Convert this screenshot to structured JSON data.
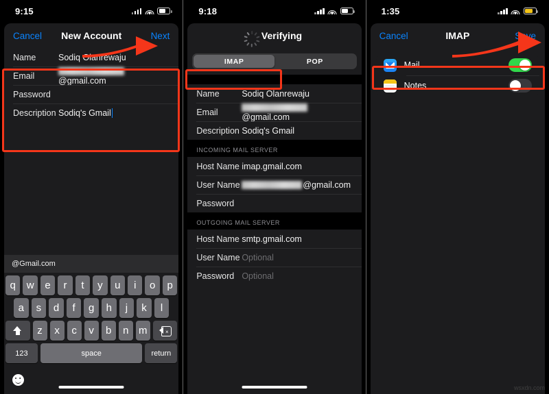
{
  "watermark": "wsxdn.com",
  "accent_blue": "#0a84ff",
  "highlight_red": "#f5361a",
  "toggle_green": "#32d74b",
  "panel1": {
    "status": {
      "time": "9:15",
      "battery": "full",
      "battery_color": "#ffffff"
    },
    "nav": {
      "left": "Cancel",
      "title": "New Account",
      "right": "Next"
    },
    "form_rows": [
      {
        "label": "Name",
        "value": "Sodiq Olanrewaju",
        "redacted": false
      },
      {
        "label": "Email",
        "value": "@gmail.com",
        "redacted": true
      },
      {
        "label": "Password",
        "value": "",
        "redacted": false
      },
      {
        "label": "Description",
        "value": "Sodiq's Gmail",
        "redacted": false
      }
    ],
    "keyboard": {
      "suggestions": [
        "@Gmail.com",
        "",
        ""
      ],
      "row1": [
        "q",
        "w",
        "e",
        "r",
        "t",
        "y",
        "u",
        "i",
        "o",
        "p"
      ],
      "row2": [
        "a",
        "s",
        "d",
        "f",
        "g",
        "h",
        "j",
        "k",
        "l"
      ],
      "row3": [
        "z",
        "x",
        "c",
        "v",
        "b",
        "n",
        "m"
      ],
      "shift_icon": "shift-icon",
      "delete_icon": "backspace-icon",
      "numbers_key": "123",
      "space_key": "space",
      "return_key": "return",
      "emoji_icon": "emoji-smiley-icon"
    }
  },
  "panel2": {
    "status": {
      "time": "9:18",
      "battery": "full",
      "battery_color": "#ffffff"
    },
    "nav": {
      "title": "Verifying",
      "spinner": "activity-spinner-icon"
    },
    "segmented": {
      "options": [
        "IMAP",
        "POP"
      ],
      "selected": "IMAP"
    },
    "account_rows": [
      {
        "label": "Name",
        "value": "Sodiq Olanrewaju",
        "redacted": false
      },
      {
        "label": "Email",
        "value": "@gmail.com",
        "redacted": true
      },
      {
        "label": "Description",
        "value": "Sodiq's Gmail",
        "redacted": false
      }
    ],
    "incoming": {
      "header": "INCOMING MAIL SERVER",
      "rows": [
        {
          "label": "Host Name",
          "value": "imap.gmail.com",
          "redacted": false,
          "placeholder": false
        },
        {
          "label": "User Name",
          "value": "@gmail.com",
          "redacted": true,
          "placeholder": false
        },
        {
          "label": "Password",
          "value": "",
          "redacted": false,
          "placeholder": false
        }
      ]
    },
    "outgoing": {
      "header": "OUTGOING MAIL SERVER",
      "rows": [
        {
          "label": "Host Name",
          "value": "smtp.gmail.com",
          "redacted": false,
          "placeholder": false
        },
        {
          "label": "User Name",
          "value": "Optional",
          "redacted": false,
          "placeholder": true
        },
        {
          "label": "Password",
          "value": "Optional",
          "redacted": false,
          "placeholder": true
        }
      ]
    }
  },
  "panel3": {
    "status": {
      "time": "1:35",
      "battery": "low-power",
      "battery_color": "#f5c518"
    },
    "nav": {
      "left": "Cancel",
      "title": "IMAP",
      "right": "Save"
    },
    "toggles": [
      {
        "label": "Mail",
        "icon": "mail-app-icon",
        "on": true
      },
      {
        "label": "Notes",
        "icon": "notes-app-icon",
        "on": false
      }
    ]
  }
}
